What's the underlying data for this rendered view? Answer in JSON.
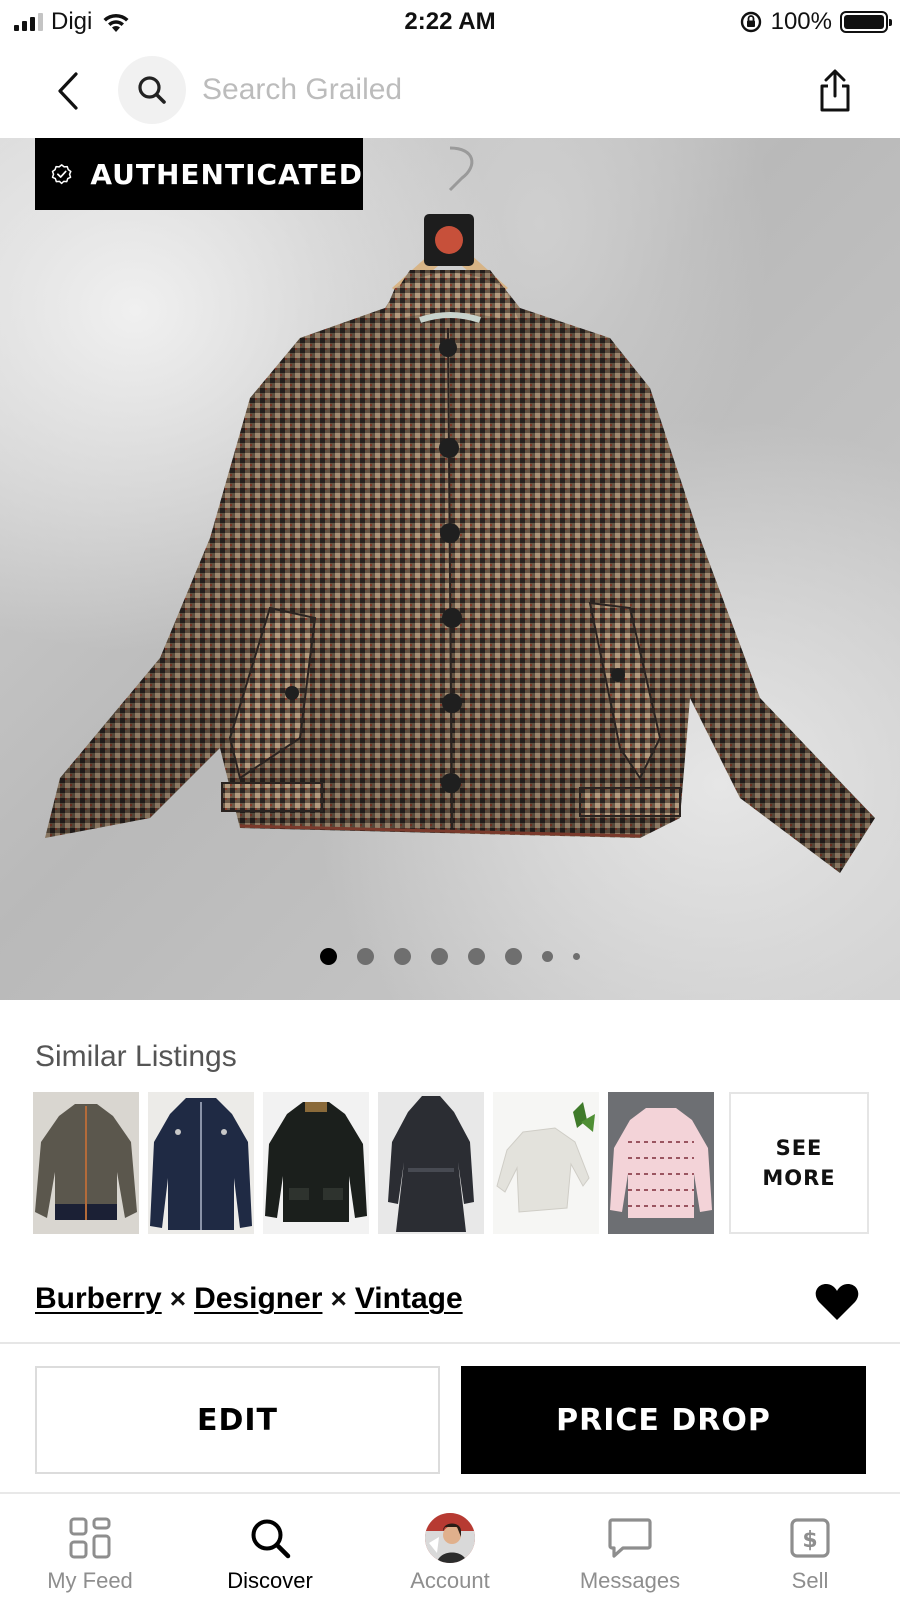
{
  "status_bar": {
    "carrier": "Digi",
    "time": "2:22 AM",
    "battery": "100%"
  },
  "nav": {
    "search_placeholder": "Search Grailed"
  },
  "listing": {
    "badge": "AUTHENTICATED",
    "image_count": 8,
    "current_image": 1,
    "designers": [
      "Burberry",
      "Designer",
      "Vintage"
    ],
    "designer_separator": "×",
    "favorited": true
  },
  "similar": {
    "title": "Similar Listings",
    "see_more": "SEE\nMORE",
    "thumbs": [
      {
        "colors": [
          "#5b574d",
          "#2c2b27",
          "#1b2035"
        ]
      },
      {
        "colors": [
          "#1f2a44",
          "#2c3858",
          "#e9e9e9"
        ]
      },
      {
        "colors": [
          "#1b1f1c",
          "#2e332e",
          "#f1f1f1"
        ]
      },
      {
        "colors": [
          "#2b2d33",
          "#474a52",
          "#e8e8e8"
        ]
      },
      {
        "colors": [
          "#e3e2dc",
          "#f6f6f4",
          "#ececec"
        ]
      },
      {
        "colors": [
          "#e9b9c1",
          "#f3d3d8",
          "#6d6f73"
        ]
      }
    ]
  },
  "actions": {
    "edit": "EDIT",
    "price_drop": "PRICE DROP"
  },
  "tabs": [
    {
      "label": "My Feed",
      "icon": "feed-icon",
      "active": false
    },
    {
      "label": "Discover",
      "icon": "search-icon",
      "active": true
    },
    {
      "label": "Account",
      "icon": "avatar",
      "active": false
    },
    {
      "label": "Messages",
      "icon": "chat-icon",
      "active": false
    },
    {
      "label": "Sell",
      "icon": "dollar-tag-icon",
      "active": false
    }
  ]
}
